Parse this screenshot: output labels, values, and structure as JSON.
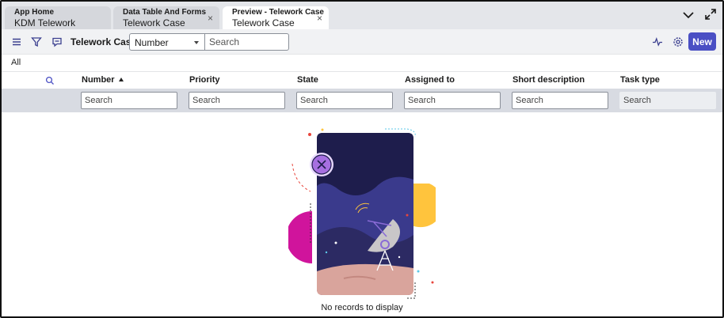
{
  "tabs": [
    {
      "title": "App Home",
      "subtitle": "KDM Telework Request",
      "active": false,
      "closable": false
    },
    {
      "title": "Data Table And Forms",
      "subtitle": "Telework Case",
      "active": false,
      "closable": true
    },
    {
      "title": "Preview - Telework Case",
      "subtitle": "Telework Case",
      "active": true,
      "closable": true
    }
  ],
  "tab_close_glyph": "×",
  "toolbar": {
    "list_title": "Telework Cases",
    "field_select_value": "Number",
    "search_placeholder": "Search",
    "new_label": "New",
    "icons": [
      "menu-icon",
      "filter-icon",
      "comment-icon",
      "activity-icon",
      "settings-icon"
    ]
  },
  "filter": {
    "label": "All"
  },
  "columns": [
    {
      "label": "Number",
      "sorted": "ascending",
      "search_placeholder": "Search",
      "searchable": true
    },
    {
      "label": "Priority",
      "search_placeholder": "Search",
      "searchable": true
    },
    {
      "label": "State",
      "search_placeholder": "Search",
      "searchable": true
    },
    {
      "label": "Assigned to",
      "search_placeholder": "Search",
      "searchable": true
    },
    {
      "label": "Short description",
      "search_placeholder": "Search",
      "searchable": true
    },
    {
      "label": "Task type",
      "search_placeholder": "Search",
      "searchable": false
    }
  ],
  "empty_state": {
    "message": "No records to display",
    "illustration": "satellite-dish-night-sky-illustration"
  },
  "colors": {
    "accent": "#4a4fc4",
    "tabbar": "#e4e6ea",
    "search_row": "#d8dbe2"
  }
}
